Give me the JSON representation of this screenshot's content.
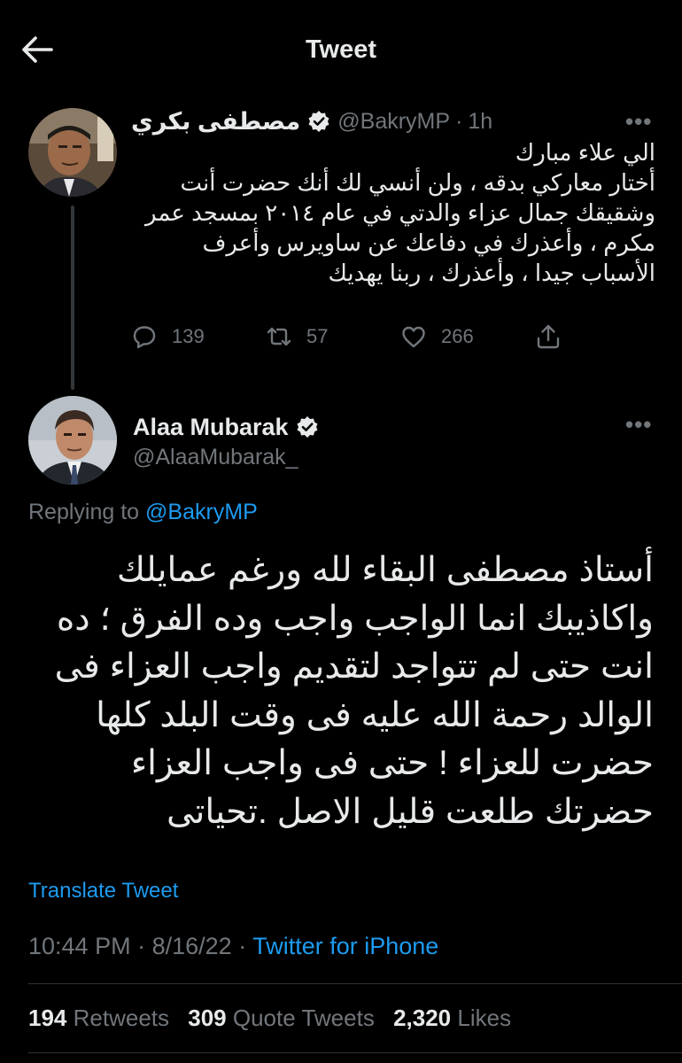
{
  "header": {
    "title": "Tweet",
    "back_icon": "arrow-left-icon"
  },
  "colors": {
    "background": "#000000",
    "text": "#e7e9ea",
    "muted": "#71767b",
    "accent": "#1d9bf0",
    "divider": "#2f3336"
  },
  "parent_tweet": {
    "name": "مصطفى بكري",
    "handle": "@BakryMP",
    "separator": "·",
    "time": "1h",
    "text_lines": [
      "الي علاء مبارك",
      "أختار معاركي بدقه ، ولن أنسي لك أنك حضرت أنت",
      "وشقيقك جمال عزاء والدتي في عام ٢٠١٤ بمسجد عمر",
      "مكرم  ، وأعذرك في دفاعك عن ساويرس وأعرف",
      "الأسباب جيدا ، وأعذرك ، ربنا يهديك"
    ],
    "replies": "139",
    "retweets": "57",
    "likes": "266"
  },
  "main_tweet": {
    "name": "Alaa Mubarak",
    "handle": "@AlaaMubarak_",
    "replying_prefix": "Replying to",
    "replying_to": "@BakryMP",
    "text_lines": [
      "أستاذ مصطفى  البقاء لله ورغم عمايلك",
      "واكاذيبك انما الواجب واجب وده الفرق ؛ ده",
      "انت حتى لم تتواجد لتقديم واجب العزاء فى",
      "الوالد رحمة الله عليه فى وقت البلد كلها",
      "حضرت للعزاء !  حتى فى واجب العزاء",
      "حضرتك طلعت قليل الاصل .تحياتى"
    ],
    "translate_label": "Translate Tweet",
    "time": "10:44 PM",
    "date": "8/16/22",
    "separator": "·",
    "client": "Twitter for iPhone",
    "stats": {
      "retweets_count": "194",
      "retweets_label": "Retweets",
      "quotes_count": "309",
      "quotes_label": "Quote Tweets",
      "likes_count": "2,320",
      "likes_label": "Likes"
    }
  },
  "more_label": "•••"
}
